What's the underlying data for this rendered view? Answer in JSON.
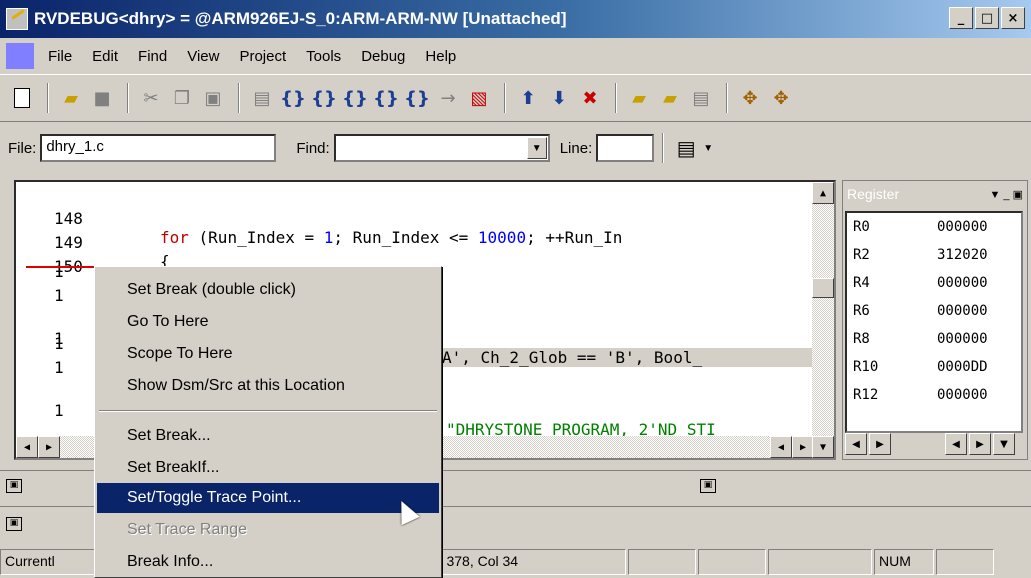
{
  "window": {
    "title": "RVDEBUG<dhry> = @ARM926EJ-S_0:ARM-ARM-NW [Unattached]",
    "min": "_",
    "max": "□",
    "close": "×"
  },
  "menu": [
    "File",
    "Edit",
    "Find",
    "View",
    "Project",
    "Tools",
    "Debug",
    "Help"
  ],
  "filebar": {
    "file_label": "File:",
    "file_value": "dhry_1.c",
    "find_label": "Find:",
    "find_value": "",
    "line_label": "Line:",
    "line_value": ""
  },
  "code": {
    "lines": [
      {
        "num": "148",
        "text_kw": "for",
        "text_rest": " (Run_Index = ",
        "text_num": "1",
        "text_rest2": "; Run_Index <= ",
        "text_num2": "10000",
        "text_rest3": "; ++Run_In"
      },
      {
        "num": "149",
        "text": "{"
      },
      {
        "num": "150",
        "text": ""
      },
      {
        "num": "1",
        "text": ""
      },
      {
        "num": "1",
        "text": ""
      },
      {
        "num": "1",
        "text": "A', Ch_2_Glob == 'B', Bool_"
      },
      {
        "num": "1",
        "text": ""
      },
      {
        "num": "1",
        "text": ""
      },
      {
        "num": "1",
        "text": "\"DHRYSTONE PROGRAM, 2'ND STI"
      }
    ]
  },
  "register": {
    "title": "Register",
    "rows": [
      {
        "name": "R0",
        "value": "000000"
      },
      {
        "name": "R2",
        "value": "312020"
      },
      {
        "name": "R4",
        "value": "000000"
      },
      {
        "name": "R6",
        "value": "000000"
      },
      {
        "name": "R8",
        "value": "000000"
      },
      {
        "name": "R10",
        "value": "0000DD"
      },
      {
        "name": "R12",
        "value": "000000"
      }
    ]
  },
  "context_menu": {
    "items": [
      {
        "label": "Set Break (double click)",
        "state": "normal"
      },
      {
        "label": "Go To Here",
        "state": "normal"
      },
      {
        "label": "Scope To Here",
        "state": "normal"
      },
      {
        "label": "Show Dsm/Src at this Location",
        "state": "normal"
      },
      {
        "label": "Set Break...",
        "state": "normal"
      },
      {
        "label": "Set BreakIf...",
        "state": "normal"
      },
      {
        "label": "Set/Toggle Trace Point...",
        "state": "selected"
      },
      {
        "label": "Set Trace Range",
        "state": "disabled"
      },
      {
        "label": "Break Info...",
        "state": "normal"
      }
    ]
  },
  "status": {
    "current": "Currentl",
    "position": "Ln 378, Col 34",
    "num": "NUM"
  },
  "colors": {
    "title_start": "#0a246a",
    "title_end": "#a6caf0",
    "menu_highlight": "#0a246a",
    "keyword": "#c00000",
    "number": "#0000ff",
    "string": "#008000"
  },
  "icons": [
    "new-document-icon",
    "open-folder-icon",
    "save-icon",
    "cut-icon",
    "copy-icon",
    "paste-icon",
    "step-icons",
    "stop-icon",
    "up-arrow-icon",
    "down-arrow-icon",
    "delete-icon"
  ]
}
